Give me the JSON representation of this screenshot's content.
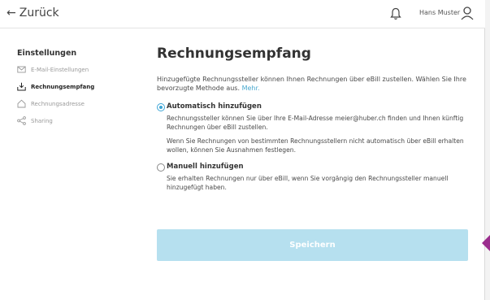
{
  "header": {
    "back_label": "Zurück",
    "bell_icon": "bell-icon",
    "user_name": "Hans Muster",
    "user_icon": "user-icon"
  },
  "sidebar": {
    "title": "Einstellungen",
    "items": [
      {
        "label": "E-Mail-Einstellungen",
        "icon": "envelope-icon",
        "active": false
      },
      {
        "label": "Rechnungsempfang",
        "icon": "inbox-download-icon",
        "active": true
      },
      {
        "label": "Rechnungsadresse",
        "icon": "home-icon",
        "active": false
      },
      {
        "label": "Sharing",
        "icon": "share-icon",
        "active": false
      }
    ]
  },
  "main": {
    "title": "Rechnungsempfang",
    "intro": "Hinzugefügte Rechnungssteller können Ihnen Rechnungen über eBill zustellen. Wählen Sie Ihre bevorzugte Methode aus.",
    "intro_link": "Mehr.",
    "options": [
      {
        "title": "Automatisch hinzufügen",
        "selected": true,
        "texts": [
          "Rechnungssteller können Sie über Ihre E-Mail-Adresse meier@huber.ch finden und Ihnen künftig Rechnungen über eBill zustellen.",
          "Wenn Sie Rechnungen von bestimmten Rechnungsstellern nicht automatisch über eBill erhalten wollen, können Sie Ausnahmen festlegen."
        ]
      },
      {
        "title": "Manuell hinzufügen",
        "selected": false,
        "texts": [
          "Sie erhalten Rechnungen nur über eBill, wenn Sie vorgängig den Rechnungssteller manuell hinzugefügt haben."
        ]
      }
    ],
    "save_label": "Speichern"
  },
  "colors": {
    "accent": "#3ca5d6",
    "button": "#b6e0ef",
    "marker": "#9b2d8e"
  }
}
